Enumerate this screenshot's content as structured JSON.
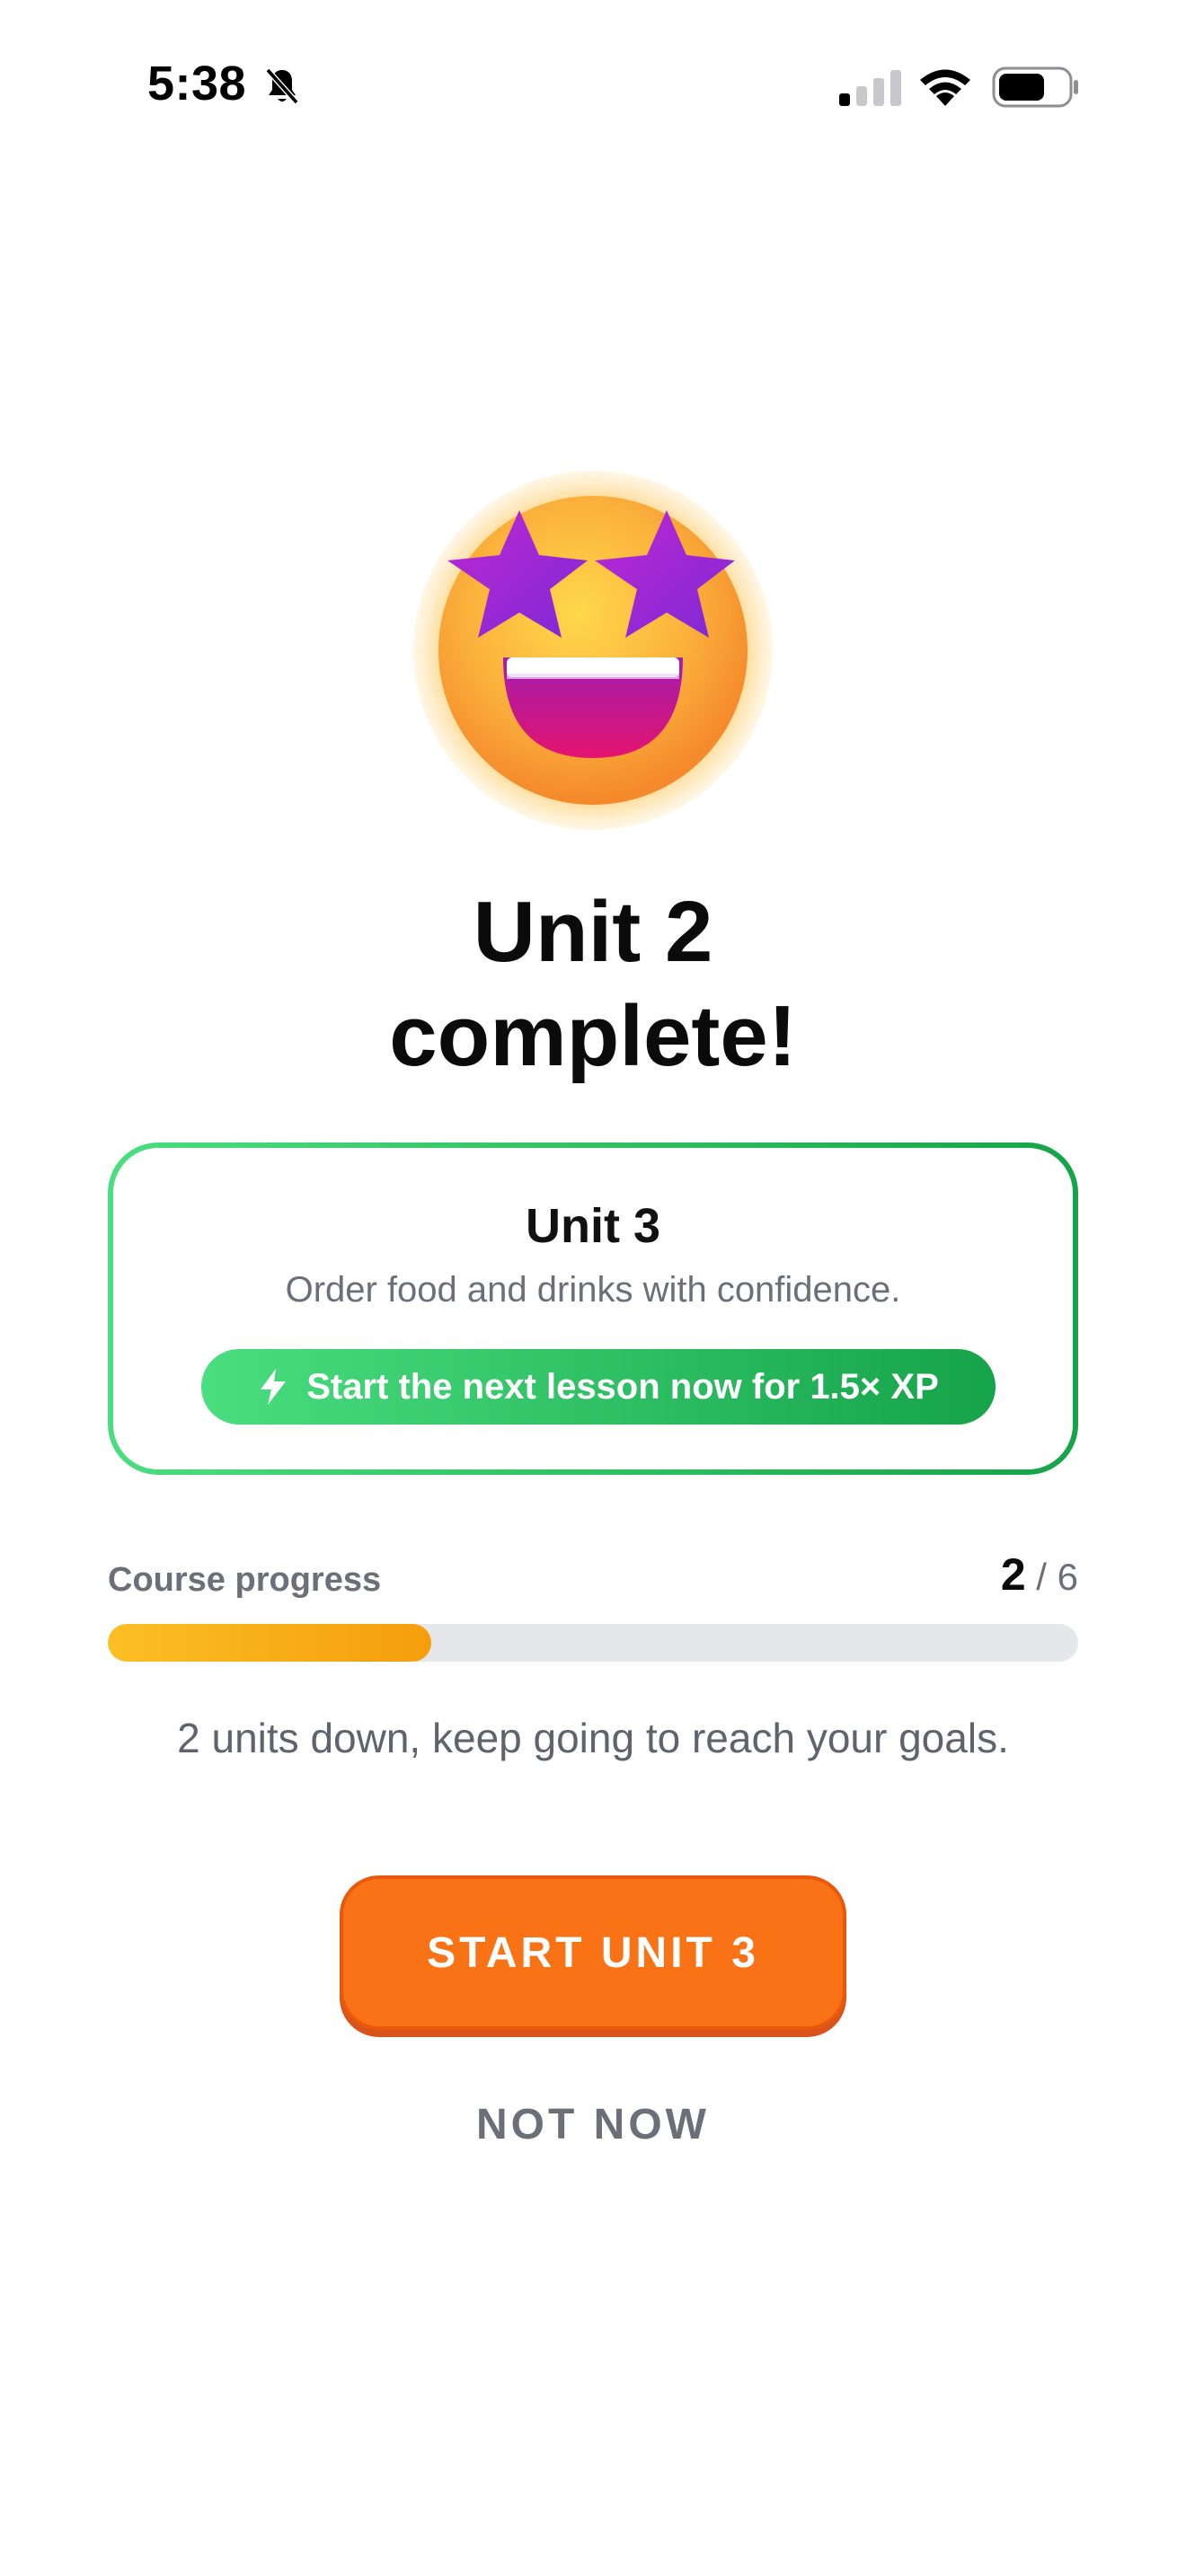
{
  "status_bar": {
    "time": "5:38",
    "icons": [
      "bell-slash-icon",
      "cellular-signal-icon",
      "wifi-icon",
      "battery-icon"
    ]
  },
  "hero": {
    "emoji": "star-struck-emoji",
    "headline_line1": "Unit 2",
    "headline_line2": "complete!"
  },
  "next_unit": {
    "title": "Unit 3",
    "description": "Order food and drinks with confidence.",
    "bonus_label": "Start the next lesson now for 1.5× XP",
    "bonus_icon": "lightning-bolt-icon"
  },
  "progress": {
    "label": "Course progress",
    "current": "2",
    "separator": " / ",
    "total": "6",
    "fraction": 0.3333,
    "caption": "2 units down, keep going to reach your goals."
  },
  "actions": {
    "primary_label": "START UNIT 3",
    "secondary_label": "NOT NOW"
  },
  "colors": {
    "accent_orange": "#f97316",
    "accent_green": "#22c55e",
    "progress_amber": "#f59e0b",
    "muted_text": "#6b6f78"
  }
}
